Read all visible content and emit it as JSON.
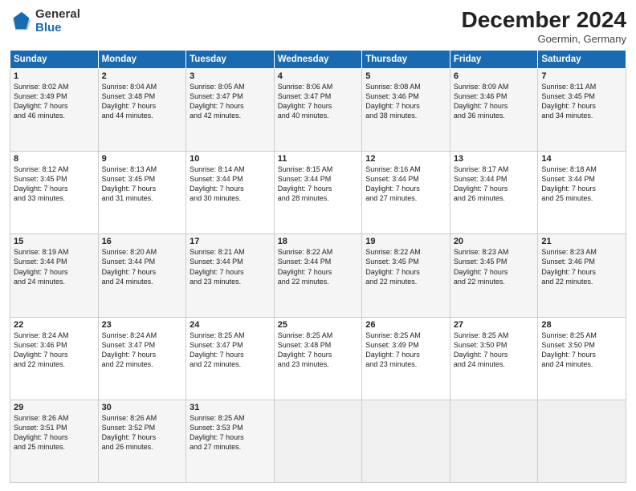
{
  "logo": {
    "general": "General",
    "blue": "Blue"
  },
  "header": {
    "month": "December 2024",
    "location": "Goermin, Germany"
  },
  "weekdays": [
    "Sunday",
    "Monday",
    "Tuesday",
    "Wednesday",
    "Thursday",
    "Friday",
    "Saturday"
  ],
  "weeks": [
    [
      {
        "day": "1",
        "lines": [
          "Sunrise: 8:02 AM",
          "Sunset: 3:49 PM",
          "Daylight: 7 hours",
          "and 46 minutes."
        ]
      },
      {
        "day": "2",
        "lines": [
          "Sunrise: 8:04 AM",
          "Sunset: 3:48 PM",
          "Daylight: 7 hours",
          "and 44 minutes."
        ]
      },
      {
        "day": "3",
        "lines": [
          "Sunrise: 8:05 AM",
          "Sunset: 3:47 PM",
          "Daylight: 7 hours",
          "and 42 minutes."
        ]
      },
      {
        "day": "4",
        "lines": [
          "Sunrise: 8:06 AM",
          "Sunset: 3:47 PM",
          "Daylight: 7 hours",
          "and 40 minutes."
        ]
      },
      {
        "day": "5",
        "lines": [
          "Sunrise: 8:08 AM",
          "Sunset: 3:46 PM",
          "Daylight: 7 hours",
          "and 38 minutes."
        ]
      },
      {
        "day": "6",
        "lines": [
          "Sunrise: 8:09 AM",
          "Sunset: 3:46 PM",
          "Daylight: 7 hours",
          "and 36 minutes."
        ]
      },
      {
        "day": "7",
        "lines": [
          "Sunrise: 8:11 AM",
          "Sunset: 3:45 PM",
          "Daylight: 7 hours",
          "and 34 minutes."
        ]
      }
    ],
    [
      {
        "day": "8",
        "lines": [
          "Sunrise: 8:12 AM",
          "Sunset: 3:45 PM",
          "Daylight: 7 hours",
          "and 33 minutes."
        ]
      },
      {
        "day": "9",
        "lines": [
          "Sunrise: 8:13 AM",
          "Sunset: 3:45 PM",
          "Daylight: 7 hours",
          "and 31 minutes."
        ]
      },
      {
        "day": "10",
        "lines": [
          "Sunrise: 8:14 AM",
          "Sunset: 3:44 PM",
          "Daylight: 7 hours",
          "and 30 minutes."
        ]
      },
      {
        "day": "11",
        "lines": [
          "Sunrise: 8:15 AM",
          "Sunset: 3:44 PM",
          "Daylight: 7 hours",
          "and 28 minutes."
        ]
      },
      {
        "day": "12",
        "lines": [
          "Sunrise: 8:16 AM",
          "Sunset: 3:44 PM",
          "Daylight: 7 hours",
          "and 27 minutes."
        ]
      },
      {
        "day": "13",
        "lines": [
          "Sunrise: 8:17 AM",
          "Sunset: 3:44 PM",
          "Daylight: 7 hours",
          "and 26 minutes."
        ]
      },
      {
        "day": "14",
        "lines": [
          "Sunrise: 8:18 AM",
          "Sunset: 3:44 PM",
          "Daylight: 7 hours",
          "and 25 minutes."
        ]
      }
    ],
    [
      {
        "day": "15",
        "lines": [
          "Sunrise: 8:19 AM",
          "Sunset: 3:44 PM",
          "Daylight: 7 hours",
          "and 24 minutes."
        ]
      },
      {
        "day": "16",
        "lines": [
          "Sunrise: 8:20 AM",
          "Sunset: 3:44 PM",
          "Daylight: 7 hours",
          "and 24 minutes."
        ]
      },
      {
        "day": "17",
        "lines": [
          "Sunrise: 8:21 AM",
          "Sunset: 3:44 PM",
          "Daylight: 7 hours",
          "and 23 minutes."
        ]
      },
      {
        "day": "18",
        "lines": [
          "Sunrise: 8:22 AM",
          "Sunset: 3:44 PM",
          "Daylight: 7 hours",
          "and 22 minutes."
        ]
      },
      {
        "day": "19",
        "lines": [
          "Sunrise: 8:22 AM",
          "Sunset: 3:45 PM",
          "Daylight: 7 hours",
          "and 22 minutes."
        ]
      },
      {
        "day": "20",
        "lines": [
          "Sunrise: 8:23 AM",
          "Sunset: 3:45 PM",
          "Daylight: 7 hours",
          "and 22 minutes."
        ]
      },
      {
        "day": "21",
        "lines": [
          "Sunrise: 8:23 AM",
          "Sunset: 3:46 PM",
          "Daylight: 7 hours",
          "and 22 minutes."
        ]
      }
    ],
    [
      {
        "day": "22",
        "lines": [
          "Sunrise: 8:24 AM",
          "Sunset: 3:46 PM",
          "Daylight: 7 hours",
          "and 22 minutes."
        ]
      },
      {
        "day": "23",
        "lines": [
          "Sunrise: 8:24 AM",
          "Sunset: 3:47 PM",
          "Daylight: 7 hours",
          "and 22 minutes."
        ]
      },
      {
        "day": "24",
        "lines": [
          "Sunrise: 8:25 AM",
          "Sunset: 3:47 PM",
          "Daylight: 7 hours",
          "and 22 minutes."
        ]
      },
      {
        "day": "25",
        "lines": [
          "Sunrise: 8:25 AM",
          "Sunset: 3:48 PM",
          "Daylight: 7 hours",
          "and 23 minutes."
        ]
      },
      {
        "day": "26",
        "lines": [
          "Sunrise: 8:25 AM",
          "Sunset: 3:49 PM",
          "Daylight: 7 hours",
          "and 23 minutes."
        ]
      },
      {
        "day": "27",
        "lines": [
          "Sunrise: 8:25 AM",
          "Sunset: 3:50 PM",
          "Daylight: 7 hours",
          "and 24 minutes."
        ]
      },
      {
        "day": "28",
        "lines": [
          "Sunrise: 8:25 AM",
          "Sunset: 3:50 PM",
          "Daylight: 7 hours",
          "and 24 minutes."
        ]
      }
    ],
    [
      {
        "day": "29",
        "lines": [
          "Sunrise: 8:26 AM",
          "Sunset: 3:51 PM",
          "Daylight: 7 hours",
          "and 25 minutes."
        ]
      },
      {
        "day": "30",
        "lines": [
          "Sunrise: 8:26 AM",
          "Sunset: 3:52 PM",
          "Daylight: 7 hours",
          "and 26 minutes."
        ]
      },
      {
        "day": "31",
        "lines": [
          "Sunrise: 8:25 AM",
          "Sunset: 3:53 PM",
          "Daylight: 7 hours",
          "and 27 minutes."
        ]
      },
      null,
      null,
      null,
      null
    ]
  ]
}
